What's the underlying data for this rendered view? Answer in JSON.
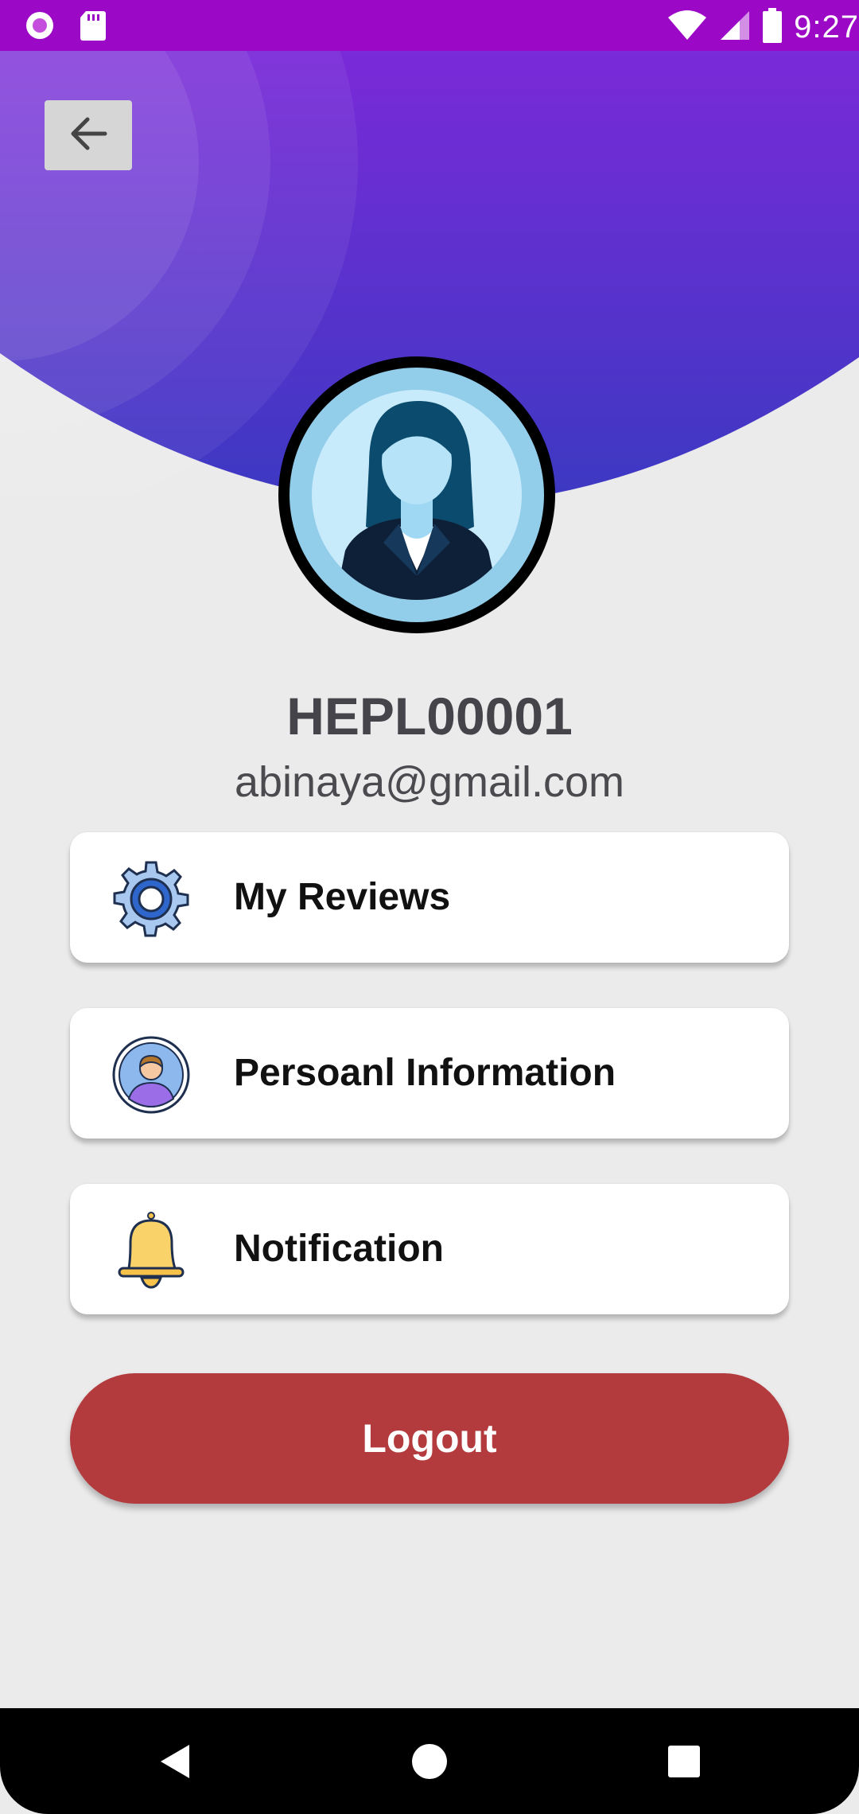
{
  "status_bar": {
    "time": "9:27",
    "icons": [
      "circle-notification-icon",
      "sd-card-icon",
      "wifi-icon",
      "cell-signal-icon",
      "battery-icon"
    ]
  },
  "header": {
    "back_icon": "arrow-left-icon",
    "gradient_colors": [
      "#8a44dd",
      "#3b39c2"
    ]
  },
  "profile": {
    "avatar_icon": "woman-avatar-icon",
    "user_id": "HEPL00001",
    "email": "abinaya@gmail.com"
  },
  "menu": [
    {
      "label": "My Reviews",
      "icon": "gear-icon"
    },
    {
      "label": "Persoanl Information",
      "icon": "person-profile-icon"
    },
    {
      "label": "Notification",
      "icon": "bell-icon"
    }
  ],
  "logout": {
    "label": "Logout",
    "color": "#b33b3d"
  },
  "nav_bar": {
    "icons": [
      "back-triangle-icon",
      "home-circle-icon",
      "recents-square-icon"
    ]
  }
}
